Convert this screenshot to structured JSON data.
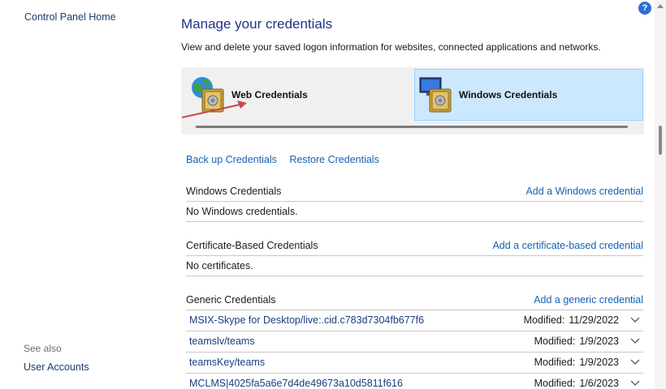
{
  "sidebar": {
    "home_link": "Control Panel Home",
    "see_also_label": "See also",
    "user_accounts_link": "User Accounts"
  },
  "main": {
    "title": "Manage your credentials",
    "description": "View and delete your saved logon information for websites, connected applications and networks."
  },
  "tabs": [
    {
      "label": "Web Credentials",
      "icon": "globe-vault-icon",
      "selected": false
    },
    {
      "label": "Windows Credentials",
      "icon": "computer-vault-icon",
      "selected": true
    }
  ],
  "actions": {
    "backup": "Back up Credentials",
    "restore": "Restore Credentials"
  },
  "sections": {
    "windows": {
      "title": "Windows Credentials",
      "action": "Add a Windows credential",
      "empty_text": "No Windows credentials."
    },
    "certificate": {
      "title": "Certificate-Based Credentials",
      "action": "Add a certificate-based credential",
      "empty_text": "No certificates."
    },
    "generic": {
      "title": "Generic Credentials",
      "action": "Add a generic credential",
      "modified_label": "Modified:",
      "items": [
        {
          "name": "MSIX-Skype for Desktop/live:.cid.c783d7304fb677f6",
          "date": "11/29/2022"
        },
        {
          "name": "teamslv/teams",
          "date": "1/9/2023"
        },
        {
          "name": "teamsKey/teams",
          "date": "1/9/2023"
        },
        {
          "name": "MCLMS|4025fa5a6e7d4de49673a10d5811f616",
          "date": "1/6/2023"
        }
      ]
    }
  },
  "help_label": "?",
  "colors": {
    "link": "#1461b6",
    "title": "#1e3287",
    "selected_tab_bg": "#cce8ff",
    "arrow": "#c9494a"
  }
}
